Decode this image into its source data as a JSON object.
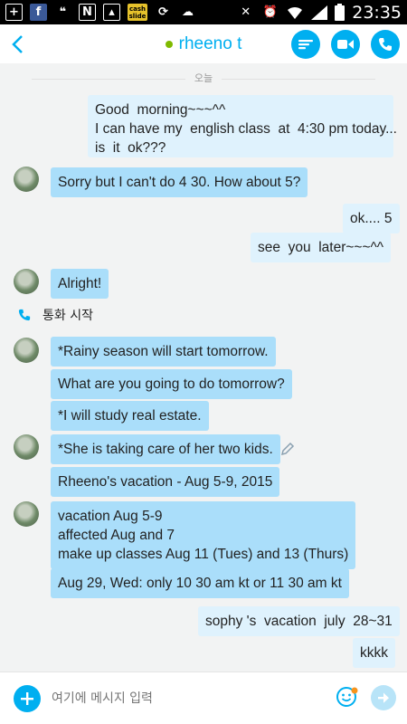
{
  "status_bar": {
    "time": "23:35",
    "icons": [
      "plus-box-icon",
      "facebook-icon",
      "quote-icon",
      "n-icon",
      "image-icon",
      "cashslide-icon",
      "sync-icon",
      "weather-icon",
      "mute-icon",
      "alarm-icon",
      "wifi-icon",
      "signal-icon",
      "battery-icon"
    ],
    "cashslide_label": "cash slide"
  },
  "header": {
    "contact_name": "rheeno t",
    "presence_color": "#7fba00",
    "accent_color": "#00aff0"
  },
  "chat": {
    "day_separator": "오늘",
    "messages": [
      {
        "side": "out",
        "text": "Good  morning~~~^^\nI can have my  english class  at  4:30 pm today...\nis  it  ok???"
      },
      {
        "side": "in",
        "text": "Sorry but I can't do 4 30. How about 5?"
      },
      {
        "side": "out",
        "text": "ok.... 5"
      },
      {
        "side": "out",
        "text": "see  you  later~~~^^"
      },
      {
        "side": "in",
        "text": "Alright!"
      },
      {
        "side": "in",
        "text": "*Rainy season will start tomorrow."
      },
      {
        "side": "in",
        "text": "What are you going to do tomorrow?"
      },
      {
        "side": "in",
        "text": "*I will study real estate."
      },
      {
        "side": "in",
        "text": "*She is taking care of her two kids."
      },
      {
        "side": "in",
        "text": "Rheeno's vacation - Aug 5-9, 2015"
      },
      {
        "side": "in",
        "text": "vacation Aug 5-9\naffected Aug and 7\nmake up classes Aug 11 (Tues) and 13 (Thurs)"
      },
      {
        "side": "in",
        "text": "Aug 29, Wed: only 10 30 am kt or 11 30 am kt"
      },
      {
        "side": "out",
        "text": "sophy 's  vacation  july  28~31"
      },
      {
        "side": "out",
        "text": "kkkk"
      }
    ],
    "call_event": "통화 시작"
  },
  "composer": {
    "placeholder": "여기에 메시지 입력"
  }
}
